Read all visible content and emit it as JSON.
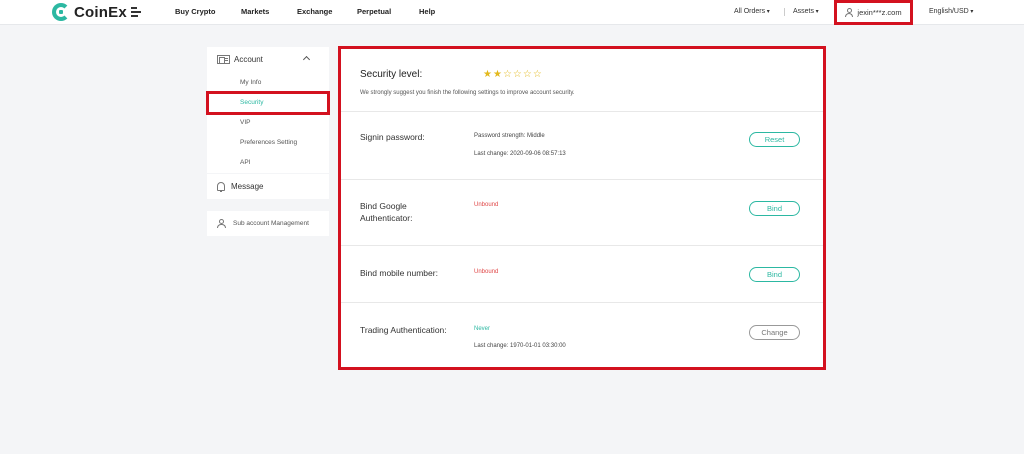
{
  "header": {
    "logo_text": "CoinEx",
    "nav": [
      "Buy Crypto",
      "Markets",
      "Exchange",
      "Perpetual",
      "Help"
    ],
    "all_orders": "All Orders",
    "assets": "Assets",
    "user_email": "jexin***z.com",
    "language": "English/USD"
  },
  "sidebar": {
    "account_label": "Account",
    "items": [
      "My Info",
      "Security",
      "VIP",
      "Preferences Setting",
      "API"
    ],
    "message_label": "Message",
    "sub_account_label": "Sub account Management"
  },
  "security": {
    "level_label": "Security level:",
    "stars_filled": 2,
    "stars_total": 6,
    "subtitle": "We strongly suggest you finish the following settings to improve account security.",
    "star_color": "#e3b91d"
  },
  "rows": {
    "signin": {
      "label": "Signin password:",
      "strength": "Password strength: Middle",
      "last_change": "Last change: 2020-09-06 08:57:13",
      "button": "Reset"
    },
    "google": {
      "label_line1": "Bind Google",
      "label_line2": "Authenticator:",
      "status": "Unbound",
      "button": "Bind"
    },
    "mobile": {
      "label": "Bind mobile number:",
      "status": "Unbound",
      "button": "Bind"
    },
    "trading": {
      "label": "Trading Authentication:",
      "status": "Never",
      "last_change": "Last change: 1970-01-01 03:30:00",
      "button": "Change"
    }
  },
  "colors": {
    "accent": "#2cb8a2",
    "highlight": "#d3111f",
    "unbound": "#e04848"
  }
}
